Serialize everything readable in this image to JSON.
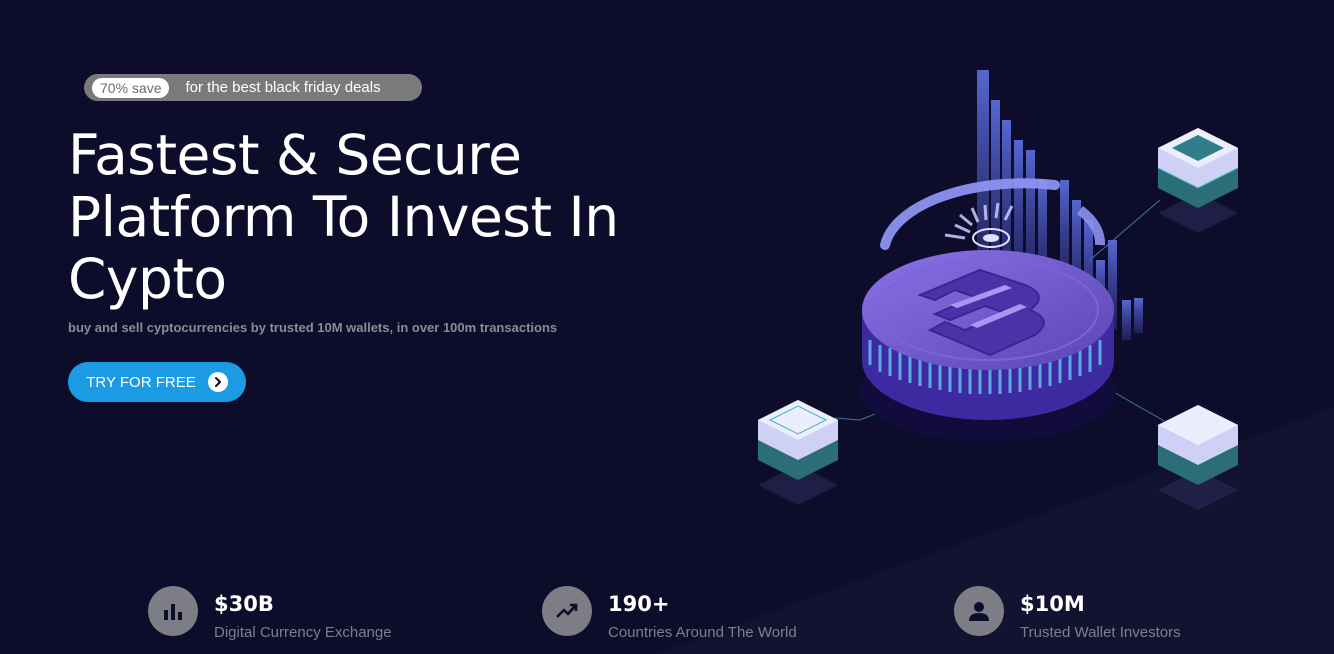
{
  "promo": {
    "badge": "70% save",
    "text": "for the best black friday deals"
  },
  "hero": {
    "title": "Fastest & Secure Platform To Invest In Cypto",
    "subtitle": "buy and sell cyptocurrencies by trusted 10M wallets, in over 100m transactions",
    "cta_label": "TRY FOR FREE",
    "cta_icon": "chevron-right-icon"
  },
  "stats": [
    {
      "icon": "bar-chart-icon",
      "value": "$30B",
      "label": "Digital Currency Exchange"
    },
    {
      "icon": "trending-up-icon",
      "value": "190+",
      "label": "Countries Around The World"
    },
    {
      "icon": "user-icon",
      "value": "$10M",
      "label": "Trusted Wallet Investors"
    }
  ],
  "colors": {
    "background": "#0d0c2b",
    "accent": "#1b9be3",
    "coin": "#6a55c8",
    "muted": "#7d7d85"
  }
}
